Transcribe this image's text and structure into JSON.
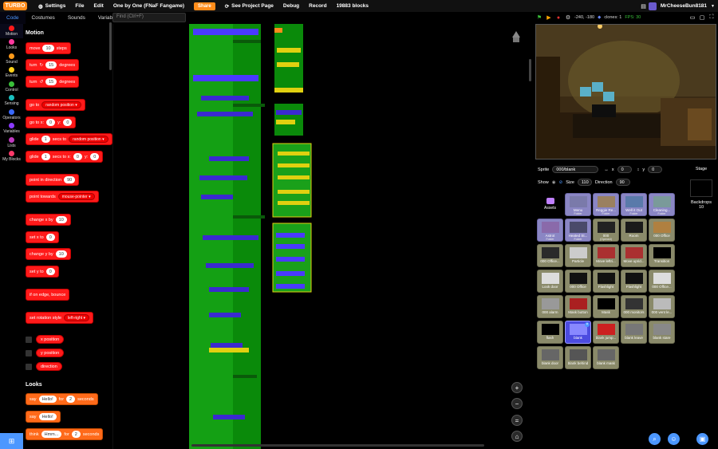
{
  "menubar": {
    "logo": "TURBO",
    "settings": "Settings",
    "file": "File",
    "edit": "Edit",
    "project_title": "One by One (FNaF Fangame)",
    "share": "Share",
    "see_project_page": "See Project Page",
    "debug": "Debug",
    "record": "Record",
    "block_count": "19883 blocks",
    "username": "MrCheeseBun8181"
  },
  "tabs": {
    "code": "Code",
    "costumes": "Costumes",
    "sounds": "Sounds",
    "variables": "Variables"
  },
  "find": {
    "placeholder": "Find (Ctrl+F)"
  },
  "categories": [
    {
      "label": "Motion",
      "color": "#ff1a1a"
    },
    {
      "label": "Looks",
      "color": "#ff3aa0"
    },
    {
      "label": "Sound",
      "color": "#ff9a1a"
    },
    {
      "label": "Events",
      "color": "#ffd21a"
    },
    {
      "label": "Control",
      "color": "#3ac03a"
    },
    {
      "label": "Sensing",
      "color": "#1ac0c0"
    },
    {
      "label": "Operators",
      "color": "#3a6aff"
    },
    {
      "label": "Variables",
      "color": "#8a3aff"
    },
    {
      "label": "Lists",
      "color": "#c03ac0"
    },
    {
      "label": "My Blocks",
      "color": "#ff3a6a"
    }
  ],
  "palette": {
    "motion_head": "Motion",
    "looks_head": "Looks",
    "move": {
      "a": "move",
      "v": "10",
      "b": "steps"
    },
    "turn_right": {
      "a": "turn",
      "v": "15",
      "b": "degrees"
    },
    "turn_left": {
      "a": "turn",
      "v": "15",
      "b": "degrees"
    },
    "go_to": {
      "a": "go to",
      "v": "random position"
    },
    "go_to_xy": {
      "a": "go to x:",
      "x": "0",
      "b": "y:",
      "y": "0"
    },
    "glide": {
      "a": "glide",
      "v": "1",
      "b": "secs to",
      "c": "random position"
    },
    "glide_xy": {
      "a": "glide",
      "v": "1",
      "b": "secs to x:",
      "x": "0",
      "c": "y:",
      "y": "0"
    },
    "point_dir": {
      "a": "point in direction",
      "v": "90"
    },
    "point_towards": {
      "a": "point towards",
      "v": "mouse-pointer"
    },
    "change_x": {
      "a": "change x by",
      "v": "10"
    },
    "set_x": {
      "a": "set x to",
      "v": "0"
    },
    "change_y": {
      "a": "change y by",
      "v": "10"
    },
    "set_y": {
      "a": "set y to",
      "v": "0"
    },
    "bounce": "if on edge, bounce",
    "rotation": {
      "a": "set rotation style",
      "v": "left-right"
    },
    "x_pos": "x position",
    "y_pos": "y position",
    "direction": "direction",
    "say_for": {
      "a": "say",
      "v": "Hello!",
      "b": "for",
      "n": "2",
      "c": "seconds"
    },
    "say": {
      "a": "say",
      "v": "Hello!"
    },
    "think_for": {
      "a": "think",
      "v": "Hmm...",
      "b": "for",
      "n": "2",
      "c": "seconds"
    }
  },
  "stage": {
    "coords": "-240, -180",
    "clones": "clones: 1",
    "fps": "FPS: 30"
  },
  "sprite_info": {
    "sprite_label": "Sprite",
    "sprite_name": "000/blank",
    "x_label": "x",
    "x": "0",
    "y_label": "y",
    "y": "0",
    "show_label": "Show",
    "size_label": "Size",
    "size": "110",
    "direction_label": "Direction",
    "direction": "90"
  },
  "sprites": {
    "assets": "Assets",
    "items": [
      {
        "name": "Menu",
        "sub": "Folder",
        "kind": "folder"
      },
      {
        "name": "Reggie Re...",
        "sub": "Folder",
        "kind": "folder"
      },
      {
        "name": "Well it Out",
        "sub": "Folder",
        "kind": "folder"
      },
      {
        "name": "Cleaning...",
        "sub": "Folder",
        "kind": "folder"
      },
      {
        "name": "Astrot",
        "sub": "Folder",
        "kind": "folder"
      },
      {
        "name": "Heated St...",
        "sub": "Folder",
        "kind": "folder"
      },
      {
        "name": "000",
        "sub": "(Opened)",
        "kind": "plain"
      },
      {
        "name": "Room",
        "sub": "",
        "kind": "plain"
      },
      {
        "name": "000 Office",
        "sub": "",
        "kind": "plain"
      },
      {
        "name": "000 Office...",
        "sub": "",
        "kind": "plain"
      },
      {
        "name": "Particle",
        "sub": "",
        "kind": "plain"
      },
      {
        "name": "Move leftri...",
        "sub": "",
        "kind": "plain"
      },
      {
        "name": "Move uprid...",
        "sub": "",
        "kind": "plain"
      },
      {
        "name": "Transition",
        "sub": "",
        "kind": "plain"
      },
      {
        "name": "Look door",
        "sub": "",
        "kind": "plain"
      },
      {
        "name": "000 Office",
        "sub": "",
        "kind": "plain"
      },
      {
        "name": "Flashlight",
        "sub": "",
        "kind": "plain"
      },
      {
        "name": "Flashlight",
        "sub": "",
        "kind": "plain"
      },
      {
        "name": "000 Office...",
        "sub": "",
        "kind": "plain"
      },
      {
        "name": "000 alarm",
        "sub": "",
        "kind": "plain"
      },
      {
        "name": "Mask button",
        "sub": "",
        "kind": "plain"
      },
      {
        "name": "Mask",
        "sub": "",
        "kind": "plain"
      },
      {
        "name": "000 monitors",
        "sub": "",
        "kind": "plain"
      },
      {
        "name": "000 vent le...",
        "sub": "",
        "kind": "plain"
      },
      {
        "name": "flash",
        "sub": "",
        "kind": "plain"
      },
      {
        "name": "blank",
        "sub": "",
        "kind": "selected"
      },
      {
        "name": "blank jump...",
        "sub": "",
        "kind": "plain"
      },
      {
        "name": "blank leave",
        "sub": "",
        "kind": "plain"
      },
      {
        "name": "blank stare",
        "sub": "",
        "kind": "plain"
      },
      {
        "name": "blank door",
        "sub": "",
        "kind": "plain"
      },
      {
        "name": "blank behind",
        "sub": "",
        "kind": "plain"
      },
      {
        "name": "blank mask",
        "sub": "",
        "kind": "plain"
      }
    ]
  },
  "stage_panel": {
    "label": "Stage",
    "backdrops_label": "Backdrops",
    "backdrops_count": "10"
  },
  "colors": {
    "accent": "#4c97ff",
    "motion": "#ff1a1a",
    "looks": "#ff6a1a",
    "control": "#1aa01a",
    "operators": "#3a3aff",
    "events": "#ffd21a"
  }
}
